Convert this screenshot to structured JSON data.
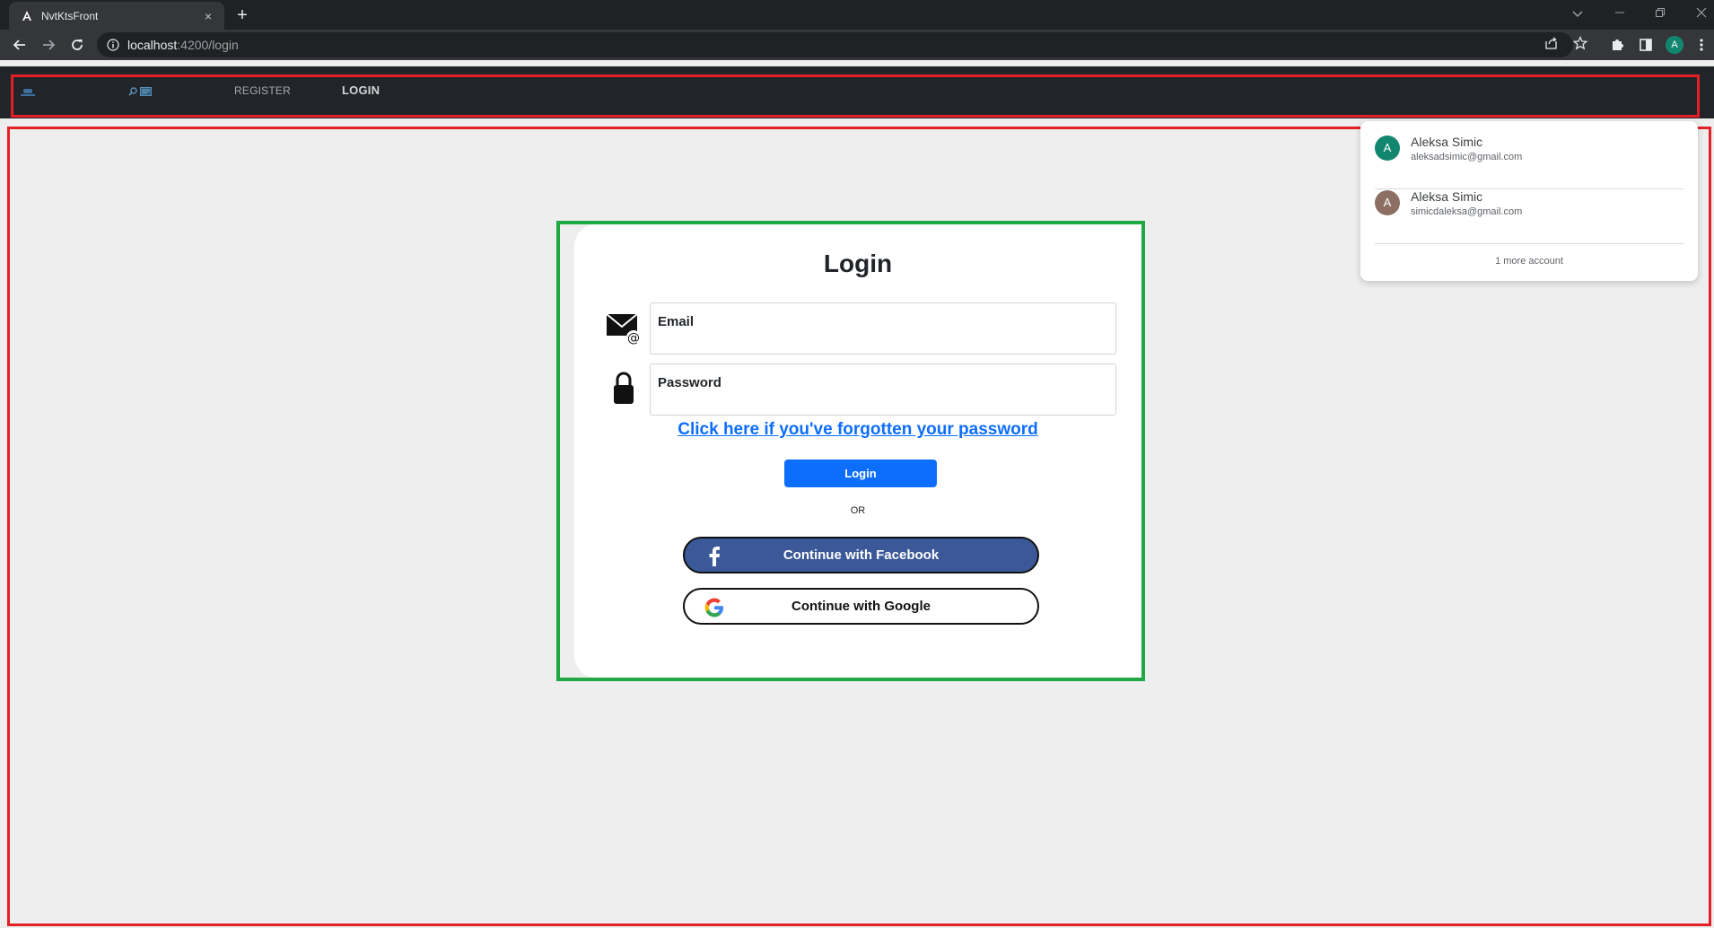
{
  "browser": {
    "tab_title": "NvtKtsFront",
    "tab_close": "×",
    "new_tab": "+",
    "url_host": "localhost",
    "url_rest": ":4200/login",
    "profile_initial": "A"
  },
  "navbar": {
    "links": [
      {
        "label": "REGISTER"
      },
      {
        "label": "LOGIN"
      }
    ]
  },
  "login": {
    "title": "Login",
    "email_label": "Email",
    "password_label": "Password",
    "forgot_link": "Click here if you've forgotten your password",
    "login_button": "Login",
    "or_text": "OR",
    "facebook_button": "Continue with Facebook",
    "google_button": "Continue with Google"
  },
  "account_chooser": {
    "accounts": [
      {
        "initial": "A",
        "name": "Aleksa Simic",
        "email": "aleksadsimic@gmail.com",
        "color": "#12866e"
      },
      {
        "initial": "A",
        "name": "Aleksa Simic",
        "email": "simicdaleksa@gmail.com",
        "color": "#8d6e63"
      }
    ],
    "more": "1 more account"
  },
  "colors": {
    "navbar_bg": "#212529",
    "primary": "#0d6efd",
    "facebook": "#3b5998",
    "highlight_red": "#e51f26",
    "highlight_green": "#1fa843"
  }
}
